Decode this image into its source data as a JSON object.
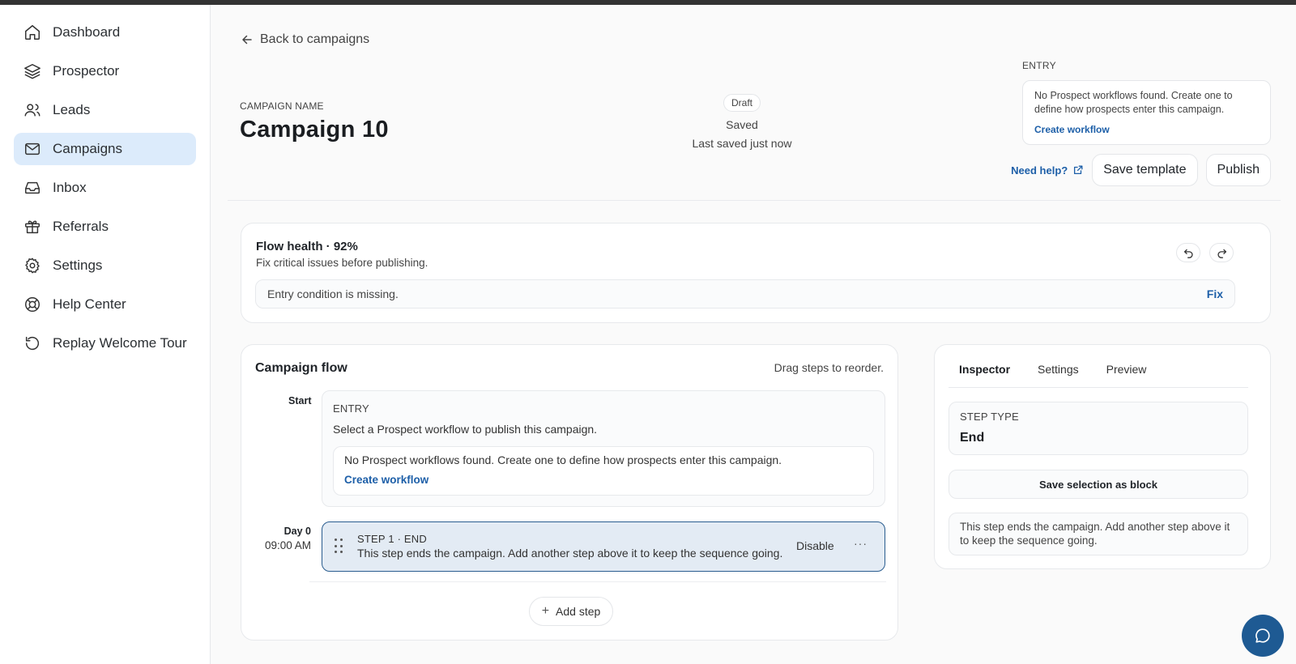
{
  "sidebar": {
    "items": [
      {
        "label": "Dashboard",
        "icon": "home-icon"
      },
      {
        "label": "Prospector",
        "icon": "layers-icon"
      },
      {
        "label": "Leads",
        "icon": "users-icon"
      },
      {
        "label": "Campaigns",
        "icon": "mail-icon",
        "active": true
      },
      {
        "label": "Inbox",
        "icon": "inbox-icon"
      },
      {
        "label": "Referrals",
        "icon": "gift-icon"
      },
      {
        "label": "Settings",
        "icon": "gear-icon"
      },
      {
        "label": "Help Center",
        "icon": "lifebuoy-icon"
      },
      {
        "label": "Replay Welcome Tour",
        "icon": "replay-icon"
      }
    ]
  },
  "header": {
    "back_label": "Back to campaigns",
    "campaign_name_label": "CAMPAIGN NAME",
    "campaign_name": "Campaign 10",
    "status_badge": "Draft",
    "save_state": "Saved",
    "last_saved": "Last saved just now",
    "entry_label": "ENTRY",
    "entry_message": "No Prospect workflows found. Create one to define how prospects enter this campaign.",
    "entry_link": "Create workflow",
    "need_help": "Need help?",
    "save_template": "Save template",
    "publish": "Publish"
  },
  "health": {
    "title": "Flow health · 92%",
    "subtitle": "Fix critical issues before publishing.",
    "issue": "Entry condition is missing.",
    "fix_label": "Fix"
  },
  "flow": {
    "title": "Campaign flow",
    "hint": "Drag steps to reorder.",
    "start_label": "Start",
    "entry": {
      "heading": "ENTRY",
      "description": "Select a Prospect workflow to publish this campaign.",
      "message": "No Prospect workflows found. Create one to define how prospects enter this campaign.",
      "link": "Create workflow"
    },
    "step": {
      "day": "Day 0",
      "time": "09:00 AM",
      "title": "STEP 1 · END",
      "description": "This step ends the campaign. Add another step above it to keep the sequence going.",
      "disable_label": "Disable",
      "more_label": "···"
    },
    "add_step": "Add step"
  },
  "inspector": {
    "tabs": [
      "Inspector",
      "Settings",
      "Preview"
    ],
    "active_tab": "Inspector",
    "step_type_label": "STEP TYPE",
    "step_type_value": "End",
    "save_selection": "Save selection as block",
    "note": "This step ends the campaign. Add another step above it to keep the sequence going."
  },
  "colors": {
    "accent": "#1d5fa8",
    "active_nav": "#dcebfb",
    "selected_step_border": "#2a5d8f",
    "chat_button": "#1e5a93"
  }
}
